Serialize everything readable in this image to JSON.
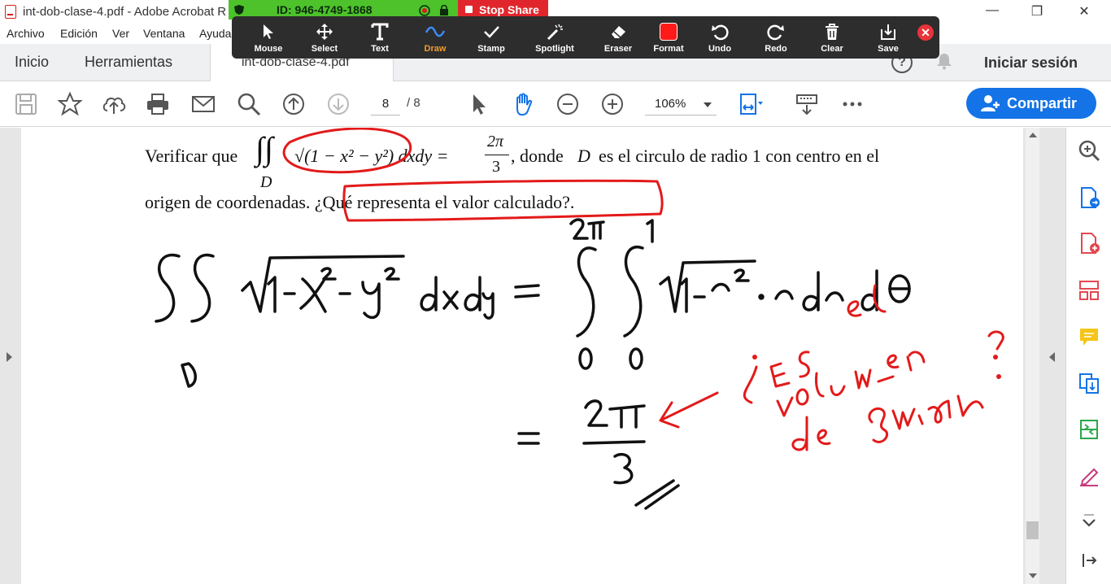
{
  "window": {
    "title": "int-dob-clase-4.pdf - Adobe Acrobat R",
    "controls": [
      "minimize",
      "restore",
      "close"
    ]
  },
  "menu": [
    "Archivo",
    "Edición",
    "Ver",
    "Ventana",
    "Ayuda"
  ],
  "tabs": {
    "home": "Inicio",
    "tools": "Herramientas",
    "document": "int-dob-clase-4.pdf",
    "help": "?",
    "signin": "Iniciar sesión"
  },
  "toolbar": {
    "page_current": "8",
    "page_total": "/ 8",
    "zoom": "106%",
    "share": "Compartir"
  },
  "meeting": {
    "id_label": "ID: 946-4749-1868",
    "stop_share": "Stop Share",
    "annotate_tools": [
      "Mouse",
      "Select",
      "Text",
      "Draw",
      "Stamp",
      "Spotlight",
      "Eraser",
      "Format",
      "Undo",
      "Redo",
      "Clear",
      "Save"
    ],
    "active_tool": "Draw",
    "format_color": "#ff1a1a",
    "active_color": "#f39c2b"
  },
  "document": {
    "line1_a": "Verificar que",
    "line1_integrand": "√(1 − x² − y²) dxdy =",
    "line1_frac_num": "2π",
    "line1_frac_den": "3",
    "line1_b": ", donde",
    "line1_D": "D",
    "line1_c": "es el circulo de radio 1 con centro en el",
    "integral_sub": "D",
    "line2": "origen de coordenadas. ¿Qué representa el valor calculado?."
  },
  "annotations": {
    "ink_color": "#e31a1a",
    "red_note_line1": "¿Es el",
    "red_note_line2": "volumen",
    "red_note_line3": "de ?",
    "result_num": "2π",
    "result_den": "3"
  },
  "right_pane_icons": [
    "zoom-pane-icon",
    "export-pdf-icon",
    "create-pdf-icon",
    "organize-pages-icon",
    "comment-icon",
    "combine-files-icon",
    "compress-icon",
    "fill-sign-icon",
    "more-tools-chevron-icon",
    "collapse-pane-icon"
  ]
}
